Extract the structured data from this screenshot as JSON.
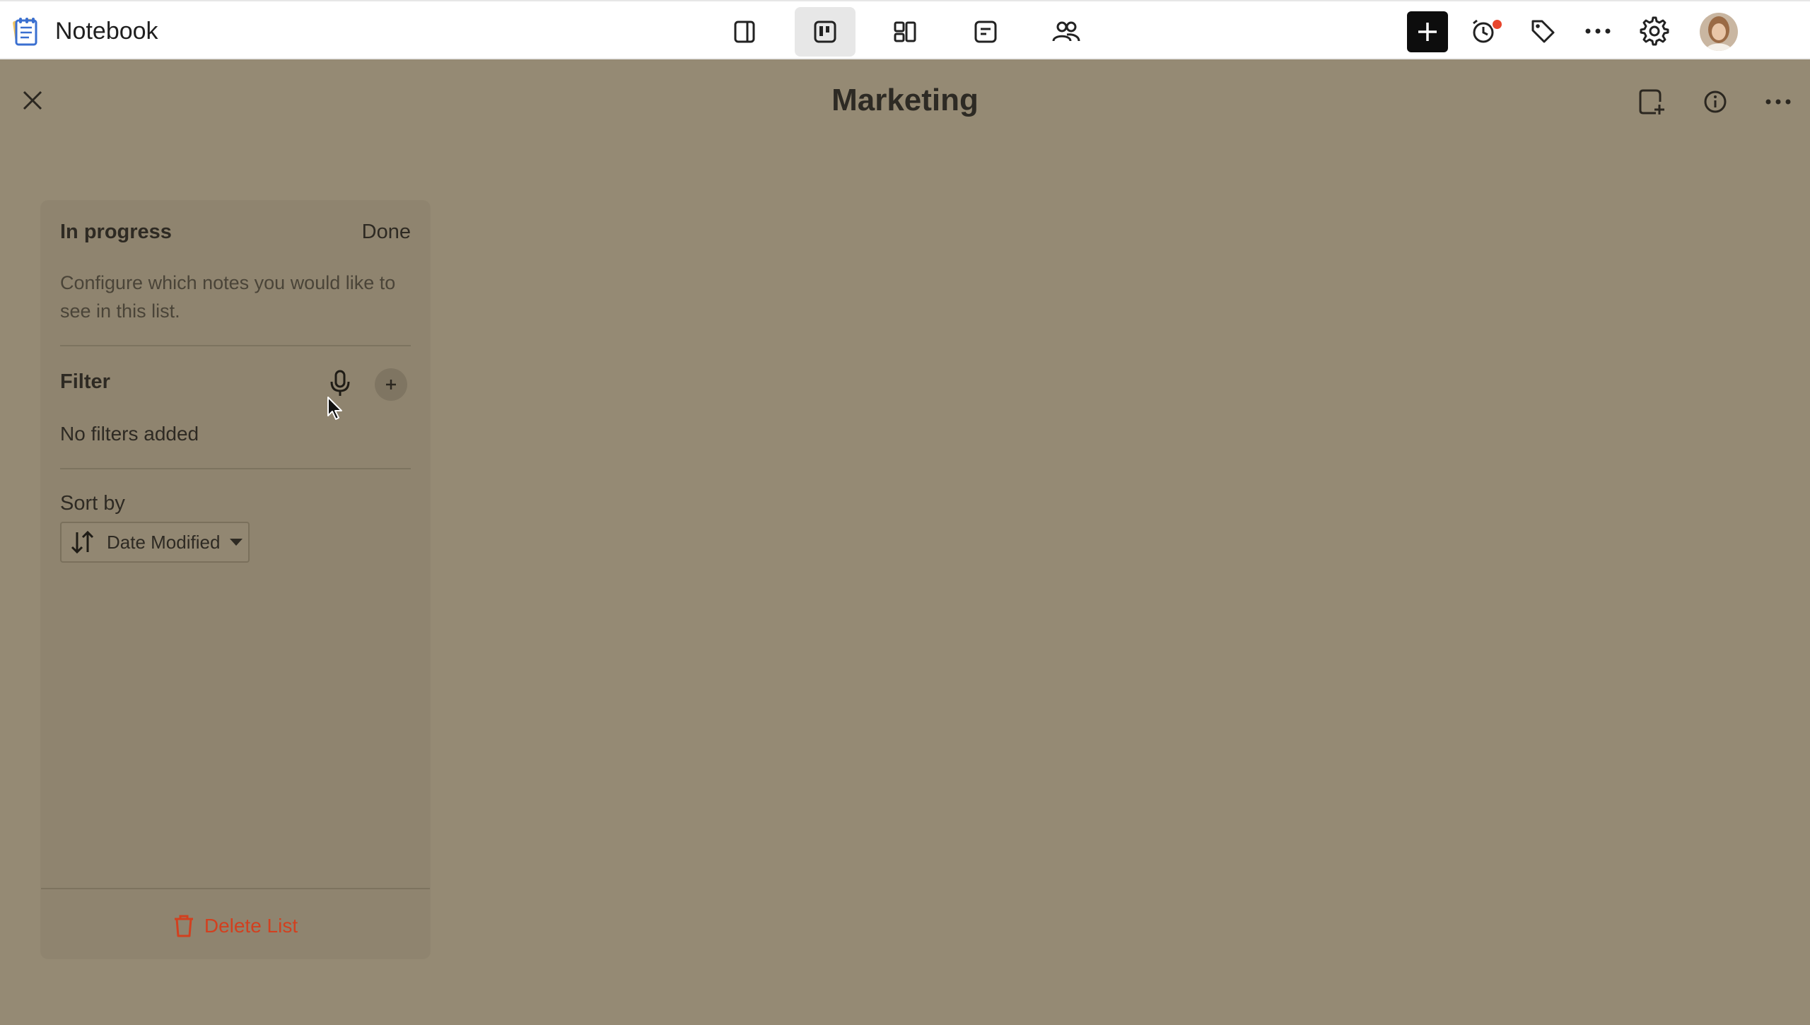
{
  "app": {
    "title": "Notebook"
  },
  "toolbar": {
    "views": [
      {
        "name": "view-sidebar",
        "icon": "sidebar-panel-icon"
      },
      {
        "name": "view-board",
        "icon": "board-view-icon",
        "active": true
      },
      {
        "name": "view-cards",
        "icon": "card-grid-icon"
      },
      {
        "name": "view-note",
        "icon": "note-view-icon"
      },
      {
        "name": "view-shared",
        "icon": "people-icon"
      }
    ],
    "actions": [
      "new-note-icon",
      "reminder-icon",
      "tag-icon",
      "more-icon",
      "settings-icon",
      "avatar"
    ]
  },
  "header": {
    "title": "Marketing",
    "icons": [
      "close-icon",
      "add-note-icon",
      "info-icon",
      "more-icon"
    ]
  },
  "panel": {
    "title": "In progress",
    "done_label": "Done",
    "description": "Configure which notes you would like to see in this list.",
    "filter_label": "Filter",
    "no_filters": "No filters added",
    "sort_label": "Sort by",
    "sort_value": "Date Modified",
    "delete_label": "Delete List"
  },
  "colors": {
    "overlay": "#958a74",
    "panel": "#8f846f",
    "danger": "#d2401f",
    "accent": "#0d0d0d"
  }
}
